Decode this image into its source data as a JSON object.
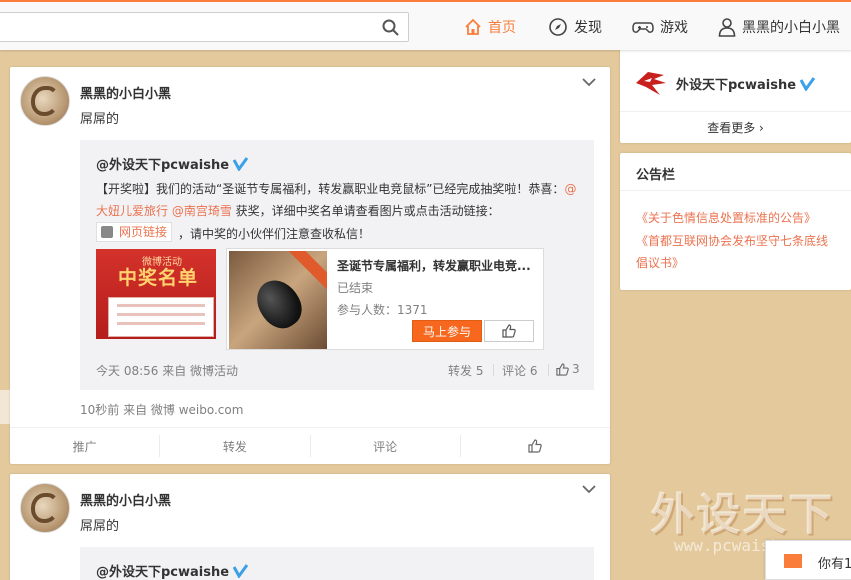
{
  "search": {
    "placeholder": ""
  },
  "nav": {
    "home": "首页",
    "discover": "发现",
    "games": "游戏",
    "profile": "黑黑的小白小黑"
  },
  "posts": [
    {
      "user": "黑黑的小白小黑",
      "text": "屌屌的",
      "repost": {
        "user": "@外设天下pcwaishe",
        "text_parts": {
          "p1": "【开奖啦】我们的活动“圣诞节专属福利，转发赢职业电竞鼠标”已经完成抽奖啦！恭喜：",
          "at1": "@大妞儿爱旅行",
          "at2": "@南宫琦雪",
          "p2": " 获奖，详细中奖名单请查看图片或点击活动链接：",
          "p3": "，请中奖的小伙伴们注意查收私信！"
        },
        "web_link": "网页链接",
        "thumb": {
          "small": "微博活动",
          "big": "中奖名单"
        },
        "card": {
          "title": "圣诞节专属福利，转发赢职业电竞...",
          "status": "已结束",
          "count": "参与人数：1371",
          "join": "马上参与"
        },
        "meta": "今天 08:56 来自 微博活动",
        "forward": "转发 5",
        "comment": "评论 6",
        "like": "3"
      },
      "meta": "10秒前 来自 微博 weibo.com",
      "actions": {
        "promote": "推广",
        "forward": "转发",
        "comment": "评论"
      }
    },
    {
      "user": "黑黑的小白小黑",
      "text": "屌屌的",
      "repost_user": "@外设天下pcwaishe"
    }
  ],
  "sidebar": {
    "account": {
      "name": "外设天下pcwaishe",
      "more": "查看更多 ›"
    },
    "notice": {
      "title": "公告栏",
      "items": [
        "《关于色情信息处置标准的公告》",
        "《首都互联网协会发布坚守七条底线",
        "倡议书》"
      ]
    }
  },
  "watermark": {
    "big": "外设天下",
    "url": "www.pcwaishe.cn"
  },
  "toast": "你有1"
}
